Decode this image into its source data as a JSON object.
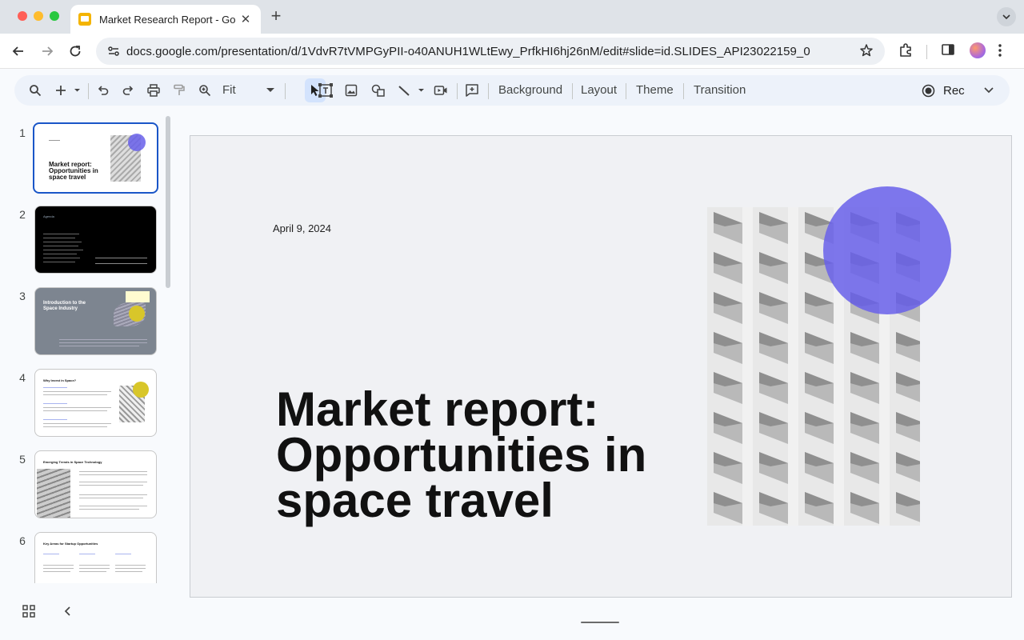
{
  "browser": {
    "tab_title": "Market Research Report - Google Slides",
    "url": "docs.google.com/presentation/d/1VdvR7tVMPGyPII-o40ANUH1WLtEwy_PrfkHI6hj26nM/edit#slide=id.SLIDES_API23022159_0"
  },
  "toolbar": {
    "zoom": "Fit",
    "background": "Background",
    "layout": "Layout",
    "theme": "Theme",
    "transition": "Transition",
    "rec": "Rec"
  },
  "filmstrip": {
    "slides": [
      {
        "number": "1",
        "title": "Market report: Opportunities in space travel",
        "selected": true
      },
      {
        "number": "2",
        "title": "Agenda"
      },
      {
        "number": "3",
        "title": "Introduction to the Space Industry"
      },
      {
        "number": "4",
        "title": "Why Invest in Space?"
      },
      {
        "number": "5",
        "title": "Emerging Trends in Space Technology"
      },
      {
        "number": "6",
        "title": "Key Areas for Startup Opportunities"
      }
    ]
  },
  "slide": {
    "date": "April 9, 2024",
    "title": "Market report: Opportunities in space travel"
  },
  "colors": {
    "accent_purple": "#6860ea",
    "selection_blue": "#1a56c8",
    "toolbar_bg": "#edf2fa"
  }
}
